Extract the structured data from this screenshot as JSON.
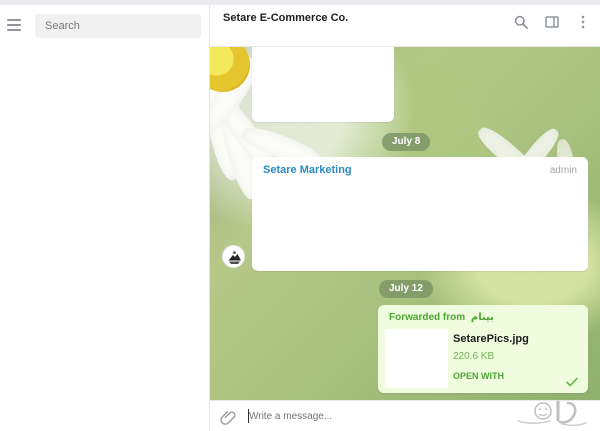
{
  "sidebar": {
    "menu_icon": "hamburger-icon",
    "search_placeholder": "Search"
  },
  "header": {
    "title": "Setare E-Commerce Co.",
    "actions": [
      {
        "icon": "search-icon"
      },
      {
        "icon": "sidebar-panel-icon"
      },
      {
        "icon": "more-vertical-icon"
      }
    ]
  },
  "messages": {
    "date_1": "July 8",
    "channel_post": {
      "author": "Setare Marketing",
      "role": "admin"
    },
    "date_2": "July 12",
    "forwarded_post": {
      "label": "Forwarded from",
      "source": "بینام",
      "file_name": "SetarePics.jpg",
      "file_size": "220.6 KB",
      "action": "OPEN WITH",
      "status_icon": "check-icon"
    }
  },
  "composer": {
    "attach_icon": "paperclip-icon",
    "placeholder": "Write a message..."
  },
  "colors": {
    "accent_blue": "#2c8cc1",
    "accent_green": "#4ca534",
    "outgoing_bubble": "#effdde",
    "date_badge": "#7d9667"
  }
}
